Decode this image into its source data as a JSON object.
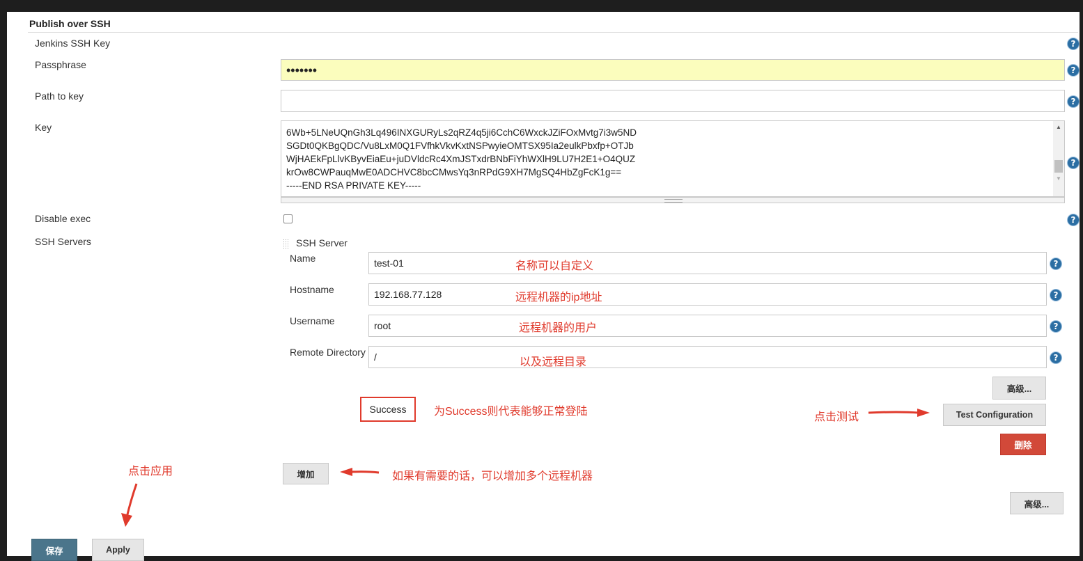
{
  "section": {
    "title": "Publish over SSH"
  },
  "labels": {
    "jenkins_ssh_key": "Jenkins SSH Key",
    "passphrase": "Passphrase",
    "path_to_key": "Path to key",
    "key": "Key",
    "disable_exec": "Disable exec",
    "ssh_servers": "SSH Servers"
  },
  "fields": {
    "passphrase_value": "•••••••",
    "path_to_key_value": ""
  },
  "key_lines": [
    "6Wb+5LNeUQnGh3Lq496INXGURyLs2qRZ4q5ji6CchC6WxckJZiFOxMvtg7i3w5ND",
    "SGDt0QKBgQDC/Vu8LxM0Q1FVfhkVkvKxtNSPwyieOMTSX95Ia2eulkPbxfp+OTJb",
    "WjHAEkFpLlvKByvEiaEu+juDVldcRc4XmJSTxdrBNbFiYhWXlH9LU7H2E1+O4QUZ",
    "krOw8CWPauqMwE0ADCHVC8bcCMwsYq3nRPdG9XH7MgSQ4HbZgFcK1g==",
    "-----END RSA PRIVATE KEY-----"
  ],
  "ssh_server": {
    "header": "SSH Server",
    "name_label": "Name",
    "name_value": "test-01",
    "hostname_label": "Hostname",
    "hostname_value": "192.168.77.128",
    "username_label": "Username",
    "username_value": "root",
    "remote_dir_label": "Remote Directory",
    "remote_dir_value": "/",
    "advanced_button": "高级...",
    "test_status": "Success",
    "test_button": "Test Configuration",
    "delete_button": "删除"
  },
  "add_button": "增加",
  "advanced_button_outer": "高级...",
  "footer": {
    "save_button": "保存",
    "apply_button": "Apply"
  },
  "annotations": {
    "name_note": "名称可以自定义",
    "hostname_note": "远程机器的ip地址",
    "username_note": "远程机器的用户",
    "remote_dir_note": "以及远程目录",
    "success_note": "为Success则代表能够正常登陆",
    "test_note": "点击测试",
    "add_note": "如果有需要的话，可以增加多个远程机器",
    "apply_note": "点击应用"
  },
  "help_icon_glyph": "?",
  "colors": {
    "accent_red": "#e03a2c",
    "passphrase_bg": "#fbfdbd",
    "save_bg": "#4b758b",
    "delete_bg": "#d24939"
  }
}
